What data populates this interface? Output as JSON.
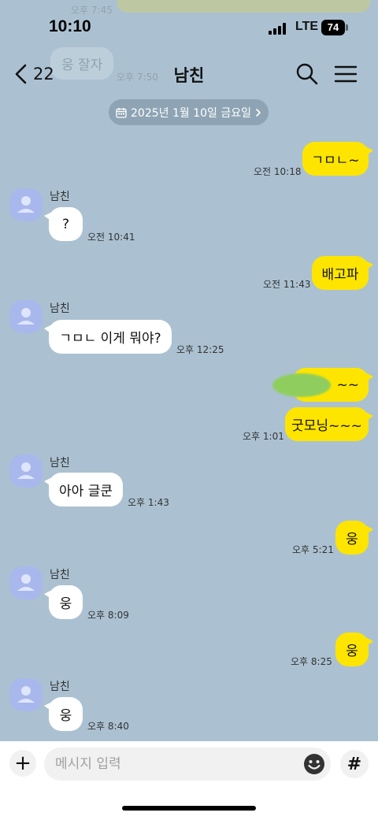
{
  "status_bar": {
    "time": "10:10",
    "network": "LTE",
    "battery": "74"
  },
  "header": {
    "back_count": "22",
    "title": "남친"
  },
  "ghost": {
    "top_time": "오후 7:45",
    "bubble_text": "웅 잘자",
    "bubble_time": "오후 7:50"
  },
  "date_divider": "2025년 1월 10일 금요일",
  "sender_name": "남친",
  "messages": [
    {
      "text": "ㄱㅁㄴ~",
      "time": "오전 10:18"
    },
    {
      "text": "?",
      "time": "오전 10:41"
    },
    {
      "text": "배고파",
      "time": "오전 11:43"
    },
    {
      "text": "ㄱㅁㄴ 이게 뭐야?",
      "time": "오후 12:25"
    },
    {
      "text": "~~",
      "time": ""
    },
    {
      "text": "굿모닝~~~",
      "time": "오후 1:01"
    },
    {
      "text": "아아 글쿤",
      "time": "오후 1:43"
    },
    {
      "text": "웅",
      "time": "오후 5:21"
    },
    {
      "text": "웅",
      "time": "오후 8:09"
    },
    {
      "text": "웅",
      "time": "오후 8:25"
    },
    {
      "text": "웅",
      "time": "오후 8:40"
    }
  ],
  "composer": {
    "placeholder": "메시지 입력",
    "hash_label": "#",
    "plus_label": "+"
  },
  "colors": {
    "background": "#abc1d1",
    "sent_bubble": "#fee500",
    "received_bubble": "#ffffff",
    "avatar": "#a8b8ec"
  }
}
